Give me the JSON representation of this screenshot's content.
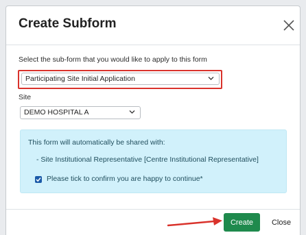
{
  "modal": {
    "title": "Create Subform",
    "close_icon": "close-x-icon"
  },
  "form": {
    "subform_label": "Select the sub-form that you would like to apply to this form",
    "subform_selected": "Participating Site Initial Application",
    "site_label": "Site",
    "site_selected": "DEMO HOSPITAL A"
  },
  "info": {
    "shared_with_text": "This form will automatically be shared with:",
    "shared_item": "-  Site Institutional Representative [Centre Institutional Representative]",
    "confirm_text": "Please tick to confirm you are happy to continue*",
    "confirm_checked": true
  },
  "footer": {
    "create_label": "Create",
    "close_label": "Close"
  },
  "annotations": {
    "highlight_color": "#d9322b",
    "arrow_color": "#d9322b"
  },
  "colors": {
    "create_button": "#1f8a4d",
    "info_background": "#d1f1fb",
    "checkbox": "#1b5aa8"
  }
}
